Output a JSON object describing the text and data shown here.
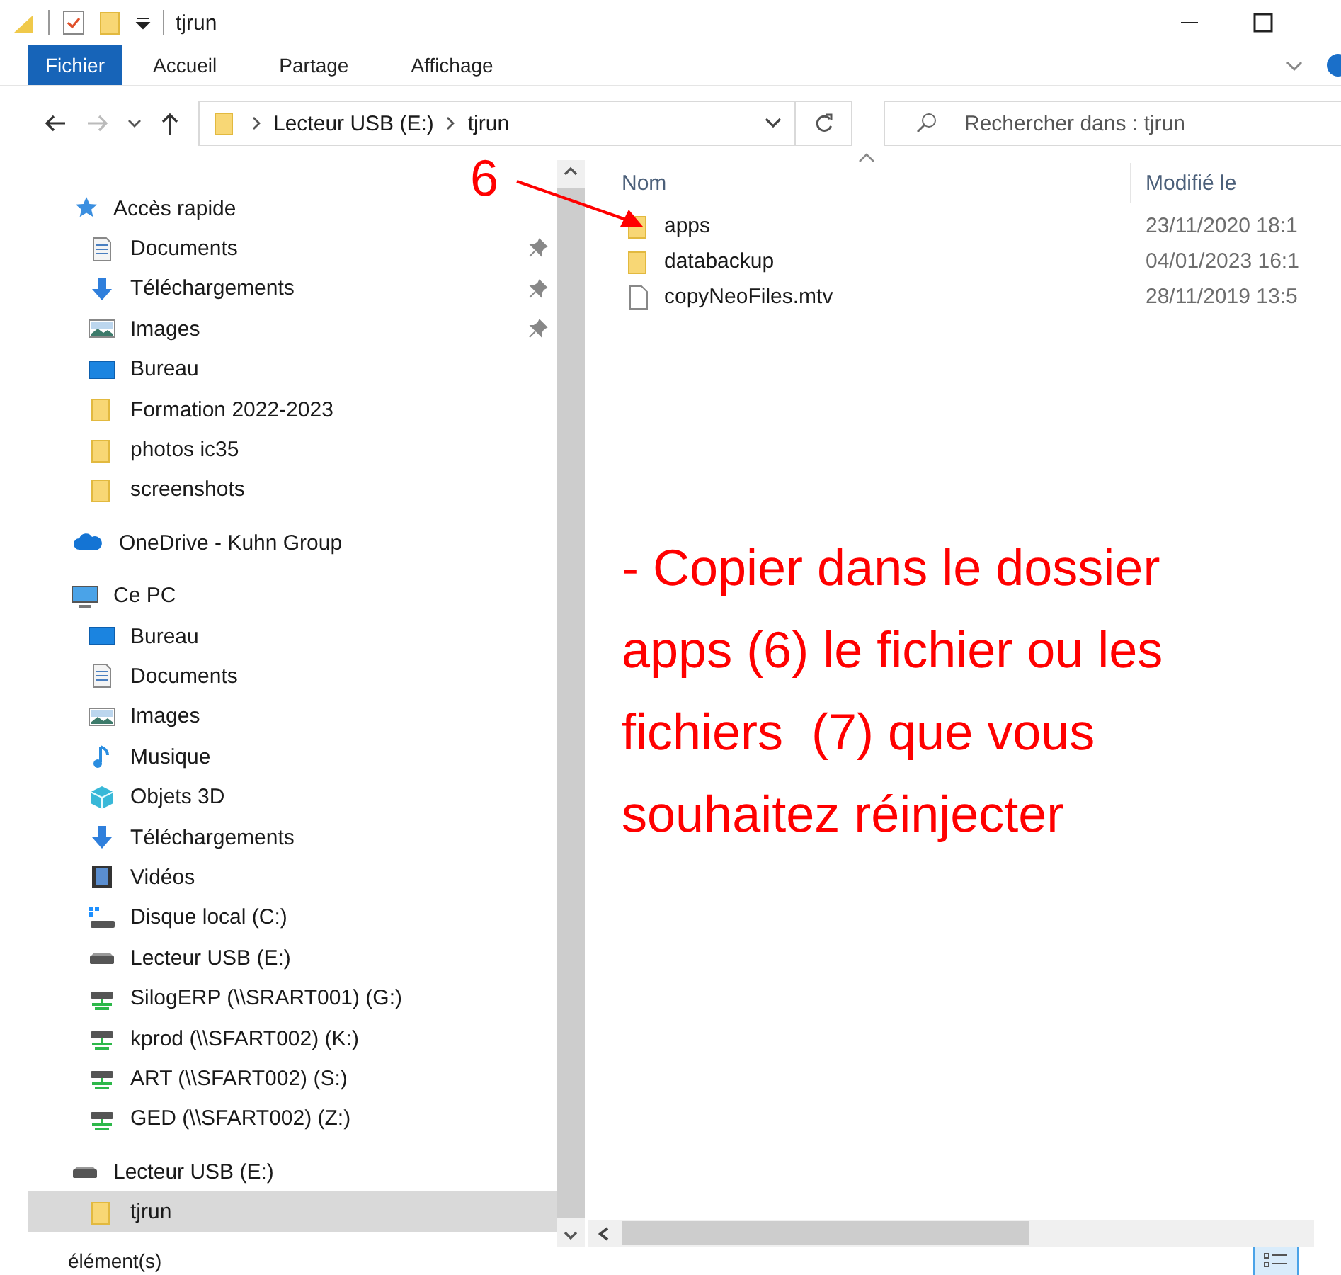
{
  "window": {
    "title": "tjrun"
  },
  "ribbon": {
    "tabs": [
      {
        "label": "Fichier",
        "selected": true
      },
      {
        "label": "Accueil",
        "selected": false
      },
      {
        "label": "Partage",
        "selected": false
      },
      {
        "label": "Affichage",
        "selected": false
      }
    ]
  },
  "address": {
    "crumbs": [
      "Lecteur USB (E:)",
      "tjrun"
    ],
    "search": {
      "placeholder": "Rechercher dans : tjrun"
    }
  },
  "sidebar": {
    "items": [
      {
        "label": "Accès rapide",
        "kind": "star",
        "pinned": false,
        "selected": false,
        "children": [
          {
            "label": "Documents",
            "kind": "document",
            "pinned": true,
            "selected": false
          },
          {
            "label": "Téléchargements",
            "kind": "download",
            "pinned": true,
            "selected": false
          },
          {
            "label": "Images",
            "kind": "picture",
            "pinned": true,
            "selected": false
          },
          {
            "label": "Bureau",
            "kind": "desktop",
            "pinned": false,
            "selected": false
          },
          {
            "label": "Formation 2022-2023",
            "kind": "folder",
            "pinned": false,
            "selected": false
          },
          {
            "label": "photos ic35",
            "kind": "folder",
            "pinned": false,
            "selected": false
          },
          {
            "label": "screenshots",
            "kind": "folder",
            "pinned": false,
            "selected": false
          }
        ]
      },
      {
        "label": "OneDrive - Kuhn Group",
        "kind": "cloud",
        "pinned": false,
        "selected": false
      },
      {
        "label": "Ce PC",
        "kind": "computer",
        "pinned": false,
        "selected": false,
        "children": [
          {
            "label": "Bureau",
            "kind": "desktop",
            "pinned": false,
            "selected": false
          },
          {
            "label": "Documents",
            "kind": "document",
            "pinned": false,
            "selected": false
          },
          {
            "label": "Images",
            "kind": "picture",
            "pinned": false,
            "selected": false
          },
          {
            "label": "Musique",
            "kind": "music",
            "pinned": false,
            "selected": false
          },
          {
            "label": "Objets 3D",
            "kind": "cube",
            "pinned": false,
            "selected": false
          },
          {
            "label": "Téléchargements",
            "kind": "download",
            "pinned": false,
            "selected": false
          },
          {
            "label": "Vidéos",
            "kind": "film",
            "pinned": false,
            "selected": false
          },
          {
            "label": "Disque local (C:)",
            "kind": "system",
            "pinned": false,
            "selected": false
          },
          {
            "label": "Lecteur USB (E:)",
            "kind": "drive",
            "pinned": false,
            "selected": false
          },
          {
            "label": "SilogERP (\\\\SRART001) (G:)",
            "kind": "network",
            "pinned": false,
            "selected": false
          },
          {
            "label": "kprod (\\\\SFART002) (K:)",
            "kind": "network",
            "pinned": false,
            "selected": false
          },
          {
            "label": "ART (\\\\SFART002) (S:)",
            "kind": "network",
            "pinned": false,
            "selected": false
          },
          {
            "label": "GED (\\\\SFART002) (Z:)",
            "kind": "network",
            "pinned": false,
            "selected": false
          }
        ]
      },
      {
        "label": "Lecteur USB (E:)",
        "kind": "drive",
        "pinned": false,
        "selected": false,
        "children": [
          {
            "label": "tjrun",
            "kind": "folder",
            "pinned": false,
            "selected": true
          }
        ]
      }
    ]
  },
  "files": {
    "columns": [
      "Nom",
      "Modifié le"
    ],
    "rows": [
      {
        "name": "apps",
        "kind": "folder",
        "modified": "23/11/2020 18:1"
      },
      {
        "name": "databackup",
        "kind": "folder",
        "modified": "04/01/2023 16:1"
      },
      {
        "name": "copyNeoFiles.mtv",
        "kind": "file",
        "modified": "28/11/2019 13:5"
      }
    ]
  },
  "annotation": {
    "marker": "6",
    "note": "- Copier dans le dossier apps (6) le fichier ou les fichiers  (7) que vous souhaitez réinjecter"
  },
  "status_bar": {
    "text": "élément(s)"
  }
}
